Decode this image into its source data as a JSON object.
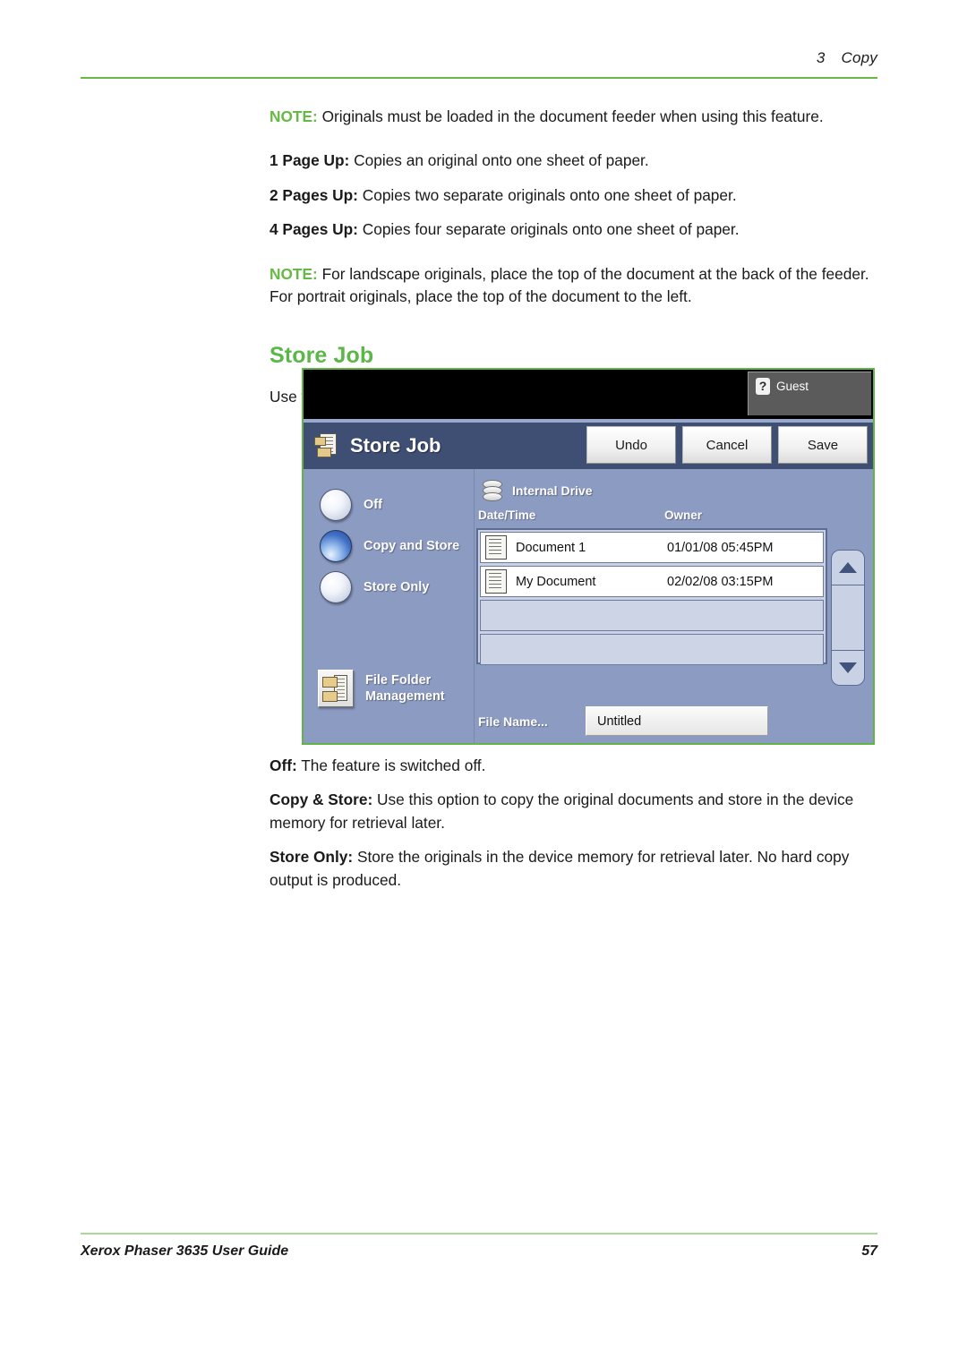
{
  "header": {
    "chapter_number": "3",
    "chapter_title": "Copy"
  },
  "body": {
    "note_label": "NOTE:",
    "note1_text": " Originals must be loaded in the document feeder when using this feature.",
    "pages_up": [
      {
        "label": "1 Page Up:",
        "text": " Copies an original onto one sheet of paper."
      },
      {
        "label": "2 Pages Up:",
        "text": " Copies two separate originals onto one sheet of paper."
      },
      {
        "label": "4 Pages Up:",
        "text": " Copies four separate originals onto one sheet of paper."
      }
    ],
    "note2_text": " For landscape originals, place the top of the document at the back of the feeder. For portrait originals, place the top of the document to the left.",
    "section_heading": "Store Job",
    "intro": "Use this feature to store files and job settings.",
    "descriptions": [
      {
        "label": "Off:",
        "text": " The feature is switched off."
      },
      {
        "label": "Copy & Store:",
        "text": " Use this option to copy the original documents and store in the device memory for retrieval later."
      },
      {
        "label": "Store Only:",
        "text": " Store the originals in the device memory for retrieval later. No hard copy output is produced."
      }
    ]
  },
  "ui": {
    "guest_tab": {
      "label": "Guest",
      "icon": "question-icon",
      "badge": "?"
    },
    "title": "Store Job",
    "title_icon": "store-job-icon",
    "buttons": [
      {
        "label": "Undo",
        "name": "undo-button"
      },
      {
        "label": "Cancel",
        "name": "cancel-button"
      },
      {
        "label": "Save",
        "name": "save-button"
      }
    ],
    "options": [
      {
        "label": "Off",
        "selected": false
      },
      {
        "label": "Copy and Store",
        "selected": true
      },
      {
        "label": "Store Only",
        "selected": false
      }
    ],
    "file_folder_management": "File Folder Management",
    "drive": {
      "label": "Internal Drive",
      "icon": "database-icon",
      "columns": [
        "Date/Time",
        "Owner"
      ],
      "rows": [
        {
          "name": "Document 1",
          "date": "01/01/08 05:45PM"
        },
        {
          "name": "My Document",
          "date": "02/02/08 03:15PM"
        },
        {
          "name": "",
          "date": ""
        },
        {
          "name": "",
          "date": ""
        }
      ]
    },
    "file_name": {
      "label": "File Name...",
      "value": "Untitled"
    },
    "scroll": {
      "up": "scroll-up-icon",
      "down": "scroll-down-icon"
    },
    "colors": {
      "panel_border": "#63b446",
      "panel_bg": "#8c9bc2",
      "titlebar": "#3f4e73",
      "accent_green": "#66b944"
    }
  },
  "footer": {
    "guide_title": "Xerox Phaser 3635 User Guide",
    "page_number": "57"
  }
}
